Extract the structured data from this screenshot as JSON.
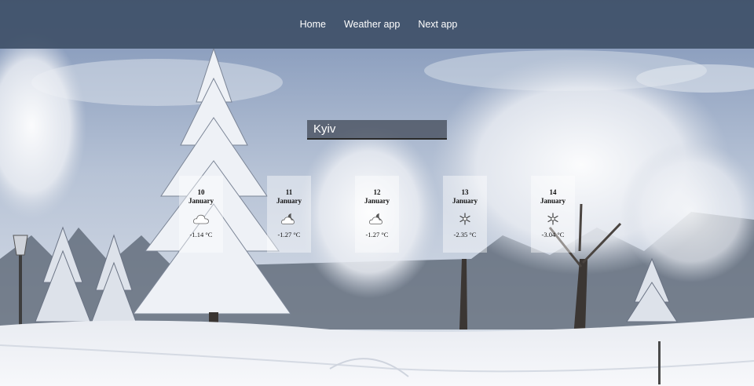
{
  "nav": {
    "items": [
      {
        "label": "Home"
      },
      {
        "label": "Weather app"
      },
      {
        "label": "Next app"
      }
    ]
  },
  "search": {
    "value": "Kyiv"
  },
  "forecast": [
    {
      "day": "10",
      "month": "January",
      "icon": "cloud-icon",
      "temp": "-1.14 °C"
    },
    {
      "day": "11",
      "month": "January",
      "icon": "partly-cloudy-night-icon",
      "temp": "-1.27 °C"
    },
    {
      "day": "12",
      "month": "January",
      "icon": "partly-cloudy-night-icon",
      "temp": "-1.27 °C"
    },
    {
      "day": "13",
      "month": "January",
      "icon": "snowflake-icon",
      "temp": "-2.35 °C"
    },
    {
      "day": "14",
      "month": "January",
      "icon": "snowflake-icon",
      "temp": "-3.04 °C"
    }
  ],
  "colors": {
    "navbar": "#3f5068",
    "card": "#ffffff",
    "sky": "#9fb0c8",
    "snow": "#f2f4f8"
  }
}
